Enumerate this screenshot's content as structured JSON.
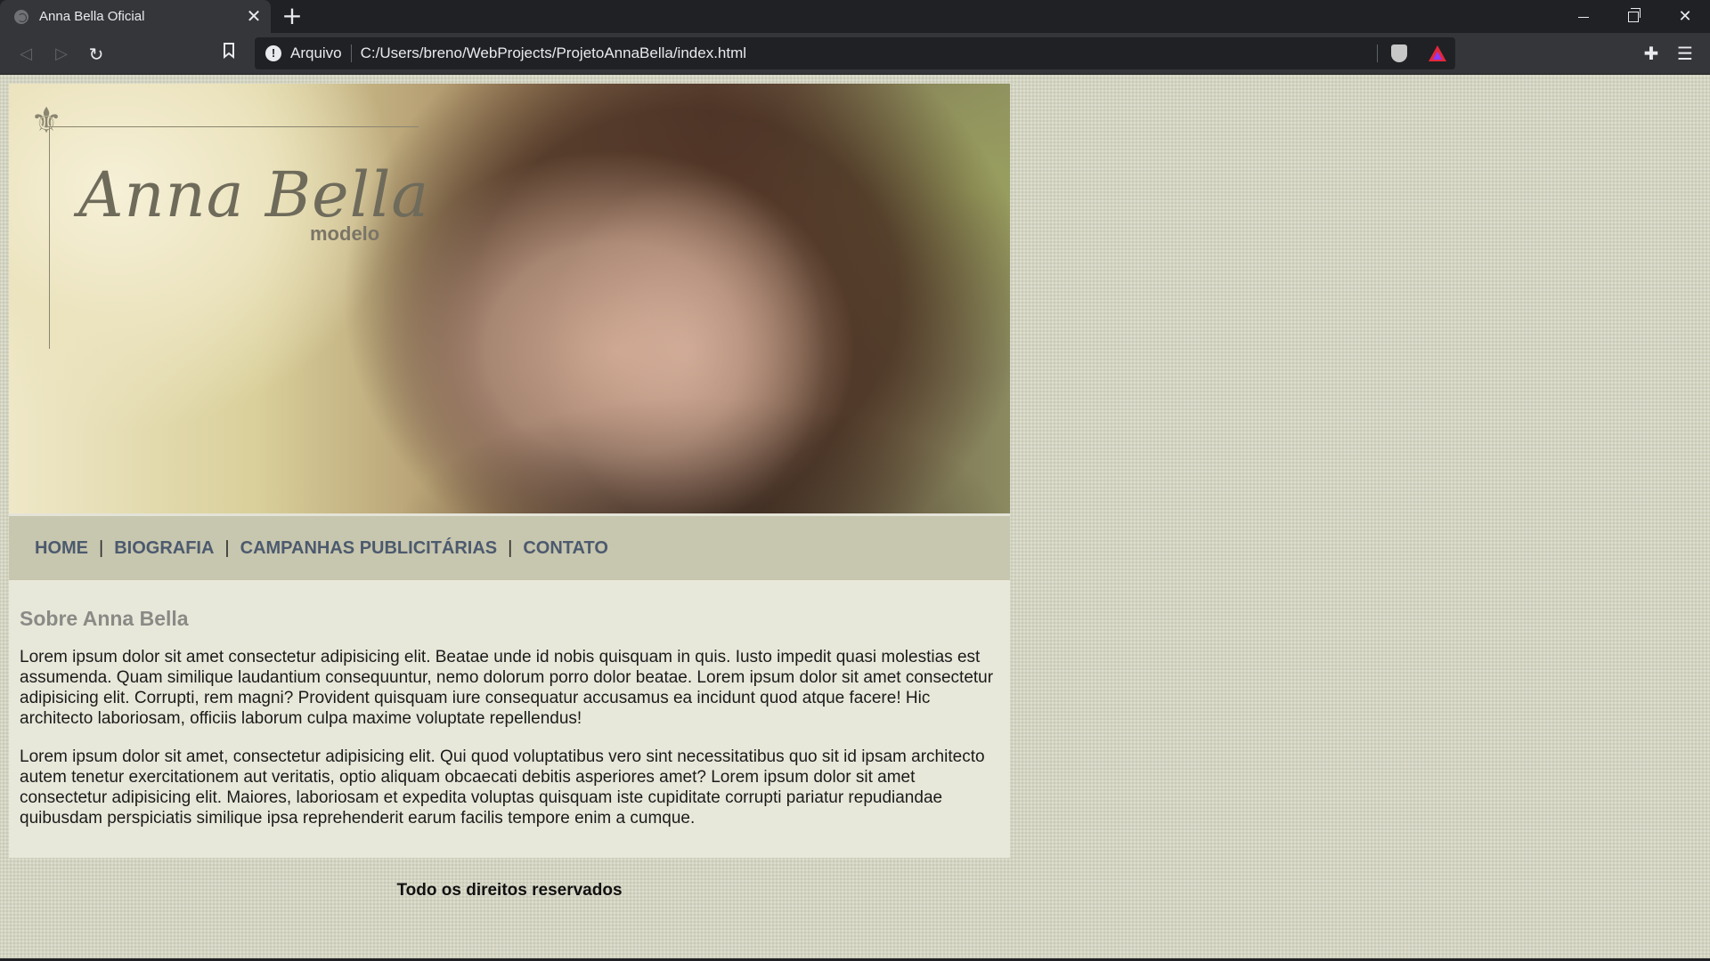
{
  "browser": {
    "tab_title": "Anna Bella Oficial",
    "tab_close": "✕",
    "new_tab": "+",
    "address_scheme": "Arquivo",
    "address_url": "C:/Users/breno/WebProjects/ProjetoAnnaBella/index.html",
    "icons": [
      "globe-icon",
      "close-icon",
      "plus-icon",
      "back-icon",
      "forward-icon",
      "reload-icon",
      "bookmark-icon",
      "info-icon",
      "brave-shield-icon",
      "brave-rewards-icon",
      "extensions-icon",
      "menu-icon",
      "minimize-icon",
      "maximize-icon",
      "close-window-icon"
    ]
  },
  "site": {
    "logo": {
      "name": "Anna Bella",
      "subtitle": "modelo"
    },
    "nav": [
      {
        "label": "HOME"
      },
      {
        "label": "BIOGRAFIA"
      },
      {
        "label": "CAMPANHAS PUBLICITÁRIAS"
      },
      {
        "label": "CONTATO"
      }
    ],
    "nav_separator": "|",
    "content": {
      "heading": "Sobre Anna Bella",
      "paragraphs": [
        "Lorem ipsum dolor sit amet consectetur adipisicing elit. Beatae unde id nobis quisquam in quis. Iusto impedit quasi molestias est assumenda. Quam similique laudantium consequuntur, nemo dolorum porro dolor beatae. Lorem ipsum dolor sit amet consectetur adipisicing elit. Corrupti, rem magni? Provident quisquam iure consequatur accusamus ea incidunt quod atque facere! Hic architecto laboriosam, officiis laborum culpa maxime voluptate repellendus!",
        "Lorem ipsum dolor sit amet, consectetur adipisicing elit. Qui quod voluptatibus vero sint necessitatibus quo sit id ipsam architecto autem tenetur exercitationem aut veritatis, optio aliquam obcaecati debitis asperiores amet? Lorem ipsum dolor sit amet consectetur adipisicing elit. Maiores, laboriosam et expedita voluptas quisquam iste cupiditate corrupti pariatur repudiandae quibusdam perspiciatis similique ipsa reprehenderit earum facilis tempore enim a cumque."
      ]
    },
    "footer": "Todo os direitos reservados"
  },
  "colors": {
    "page_bg": "#d4d4c2",
    "nav_bg": "#c7c6ae",
    "nav_link": "#4c5a6e",
    "content_bg": "#e8e8da",
    "heading": "#8a8a86"
  }
}
